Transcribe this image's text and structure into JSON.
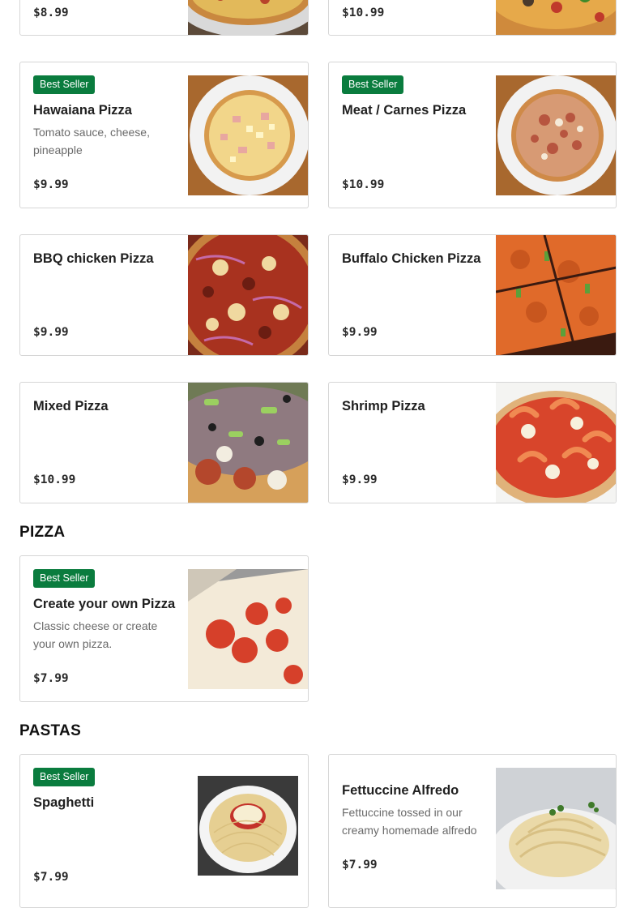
{
  "badge_label": "Best Seller",
  "colors": {
    "badge_bg": "#0a7c3e",
    "card_border": "#d6d6d6",
    "price_text": "#2a2a2a"
  },
  "top_partial": {
    "left": {
      "price": "$8.99",
      "image_icon": "pizza-photo"
    },
    "right": {
      "price": "$10.99",
      "image_icon": "pizza-photo"
    }
  },
  "specialty": {
    "items": [
      {
        "name": "Hawaiana Pizza",
        "description": "Tomato sauce, cheese, pineapple",
        "price": "$9.99",
        "best_seller": true
      },
      {
        "name": "Meat / Carnes Pizza",
        "description": "",
        "price": "$10.99",
        "best_seller": true
      },
      {
        "name": "BBQ chicken Pizza",
        "description": "",
        "price": "$9.99",
        "best_seller": false
      },
      {
        "name": "Buffalo Chicken Pizza",
        "description": "",
        "price": "$9.99",
        "best_seller": false
      },
      {
        "name": "Mixed Pizza",
        "description": "",
        "price": "$10.99",
        "best_seller": false
      },
      {
        "name": "Shrimp Pizza",
        "description": "",
        "price": "$9.99",
        "best_seller": false
      }
    ]
  },
  "pizza_section": {
    "title": "PIZZA",
    "items": [
      {
        "name": "Create your own Pizza",
        "description": "Classic cheese or create your own pizza.",
        "price": "$7.99",
        "best_seller": true
      }
    ]
  },
  "pastas_section": {
    "title": "PASTAS",
    "items": [
      {
        "name": "Spaghetti",
        "description": "",
        "price": "$7.99",
        "best_seller": true
      },
      {
        "name": "Fettuccine Alfredo",
        "description": "Fettuccine tossed in our creamy homemade alfredo sauce.",
        "price": "$7.99",
        "best_seller": false
      }
    ]
  }
}
